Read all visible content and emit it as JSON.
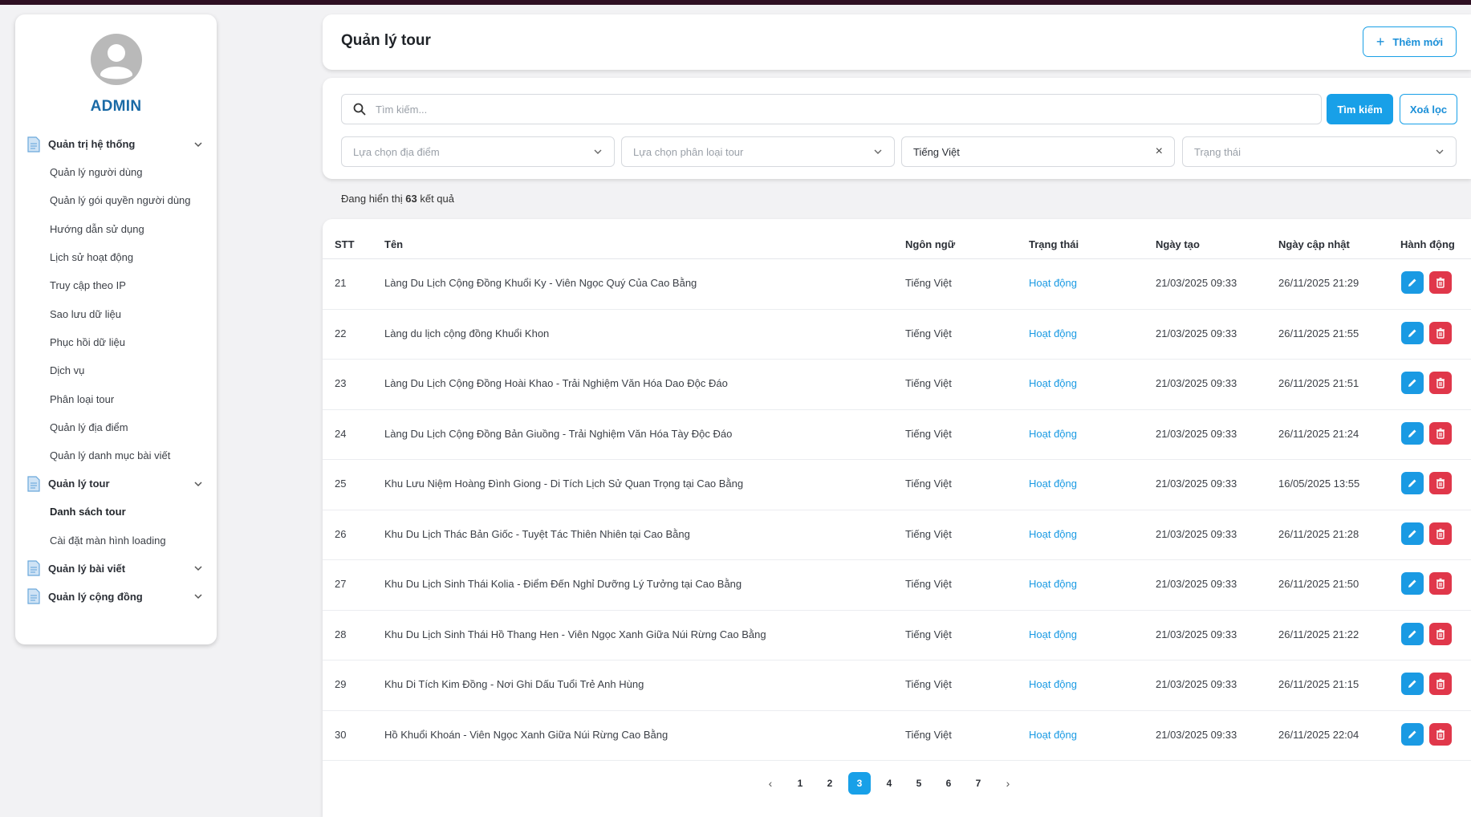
{
  "sidebar": {
    "user_name": "ADMIN",
    "groups": [
      {
        "label": "Quản trị hệ thống",
        "items": [
          "Quản lý người dùng",
          "Quản lý gói quyền người dùng",
          "Hướng dẫn sử dụng",
          "Lịch sử hoạt động",
          "Truy cập theo IP",
          "Sao lưu dữ liệu",
          "Phục hồi dữ liệu",
          "Dịch vụ",
          "Phân loại tour",
          "Quản lý địa điểm",
          "Quản lý danh mục bài viết"
        ]
      },
      {
        "label": "Quản lý tour",
        "items": [
          "Danh sách tour",
          "Cài đặt màn hình loading"
        ],
        "active_item": "Danh sách tour"
      },
      {
        "label": "Quản lý bài viết",
        "items": []
      },
      {
        "label": "Quản lý cộng đồng",
        "items": []
      }
    ]
  },
  "header": {
    "title": "Quản lý tour",
    "add_label": "Thêm mới"
  },
  "filters": {
    "search_placeholder": "Tìm kiếm...",
    "search_button": "Tìm kiếm",
    "clear_button": "Xoá lọc",
    "location_placeholder": "Lựa chọn địa điểm",
    "category_placeholder": "Lựa chọn phân loại tour",
    "language_value": "Tiếng Việt",
    "status_placeholder": "Trạng thái"
  },
  "results": {
    "prefix": "Đang hiển thị",
    "count": "63",
    "suffix": "kết quả"
  },
  "table": {
    "headers": {
      "stt": "STT",
      "name": "Tên",
      "lang": "Ngôn ngữ",
      "status": "Trạng thái",
      "created": "Ngày tạo",
      "updated": "Ngày cập nhật",
      "actions": "Hành động"
    },
    "rows": [
      {
        "stt": "21",
        "name": "Làng Du Lịch Cộng Đồng Khuổi Ky - Viên Ngọc Quý Của Cao Bằng",
        "lang": "Tiếng Việt",
        "status": "Hoạt động",
        "created": "21/03/2025 09:33",
        "updated": "26/11/2025 21:29"
      },
      {
        "stt": "22",
        "name": "Làng du lịch cộng đồng Khuổi Khon",
        "lang": "Tiếng Việt",
        "status": "Hoạt động",
        "created": "21/03/2025 09:33",
        "updated": "26/11/2025 21:55"
      },
      {
        "stt": "23",
        "name": "Làng Du Lịch Cộng Đồng Hoài Khao - Trải Nghiệm Văn Hóa Dao Độc Đáo",
        "lang": "Tiếng Việt",
        "status": "Hoạt động",
        "created": "21/03/2025 09:33",
        "updated": "26/11/2025 21:51"
      },
      {
        "stt": "24",
        "name": "Làng Du Lịch Cộng Đồng Bản Giuồng - Trải Nghiệm Văn Hóa Tày Độc Đáo",
        "lang": "Tiếng Việt",
        "status": "Hoạt động",
        "created": "21/03/2025 09:33",
        "updated": "26/11/2025 21:24"
      },
      {
        "stt": "25",
        "name": "Khu Lưu Niệm Hoàng Đình Giong - Di Tích Lịch Sử Quan Trọng tại Cao Bằng",
        "lang": "Tiếng Việt",
        "status": "Hoạt động",
        "created": "21/03/2025 09:33",
        "updated": "16/05/2025 13:55"
      },
      {
        "stt": "26",
        "name": "Khu Du Lịch Thác Bản Giốc - Tuyệt Tác Thiên Nhiên tại Cao Bằng",
        "lang": "Tiếng Việt",
        "status": "Hoạt động",
        "created": "21/03/2025 09:33",
        "updated": "26/11/2025 21:28"
      },
      {
        "stt": "27",
        "name": "Khu Du Lịch Sinh Thái Kolia - Điểm Đến Nghỉ Dưỡng Lý Tưởng tại Cao Bằng",
        "lang": "Tiếng Việt",
        "status": "Hoạt động",
        "created": "21/03/2025 09:33",
        "updated": "26/11/2025 21:50"
      },
      {
        "stt": "28",
        "name": "Khu Du Lịch Sinh Thái Hồ Thang Hen - Viên Ngọc Xanh Giữa Núi Rừng Cao Bằng",
        "lang": "Tiếng Việt",
        "status": "Hoạt động",
        "created": "21/03/2025 09:33",
        "updated": "26/11/2025 21:22"
      },
      {
        "stt": "29",
        "name": "Khu Di Tích Kim Đồng - Nơi Ghi Dấu Tuổi Trẻ Anh Hùng",
        "lang": "Tiếng Việt",
        "status": "Hoạt động",
        "created": "21/03/2025 09:33",
        "updated": "26/11/2025 21:15"
      },
      {
        "stt": "30",
        "name": "Hồ Khuổi Khoán - Viên Ngọc Xanh Giữa Núi Rừng Cao Bằng",
        "lang": "Tiếng Việt",
        "status": "Hoạt động",
        "created": "21/03/2025 09:33",
        "updated": "26/11/2025 22:04"
      }
    ]
  },
  "pagination": {
    "prev": "‹",
    "next": "›",
    "pages": [
      "1",
      "2",
      "3",
      "4",
      "5",
      "6",
      "7"
    ],
    "current": "3"
  },
  "colors": {
    "accent": "#18a0e8",
    "danger": "#e0374a",
    "brand_text": "#1a6aa6",
    "status_active": "#1a9ae3"
  },
  "icons": {
    "search": "search-icon",
    "add": "plus-icon",
    "edit": "pencil-icon",
    "delete": "trash-icon",
    "chevron": "chevron-down-icon",
    "clear": "close-icon",
    "folder": "document-icon"
  }
}
